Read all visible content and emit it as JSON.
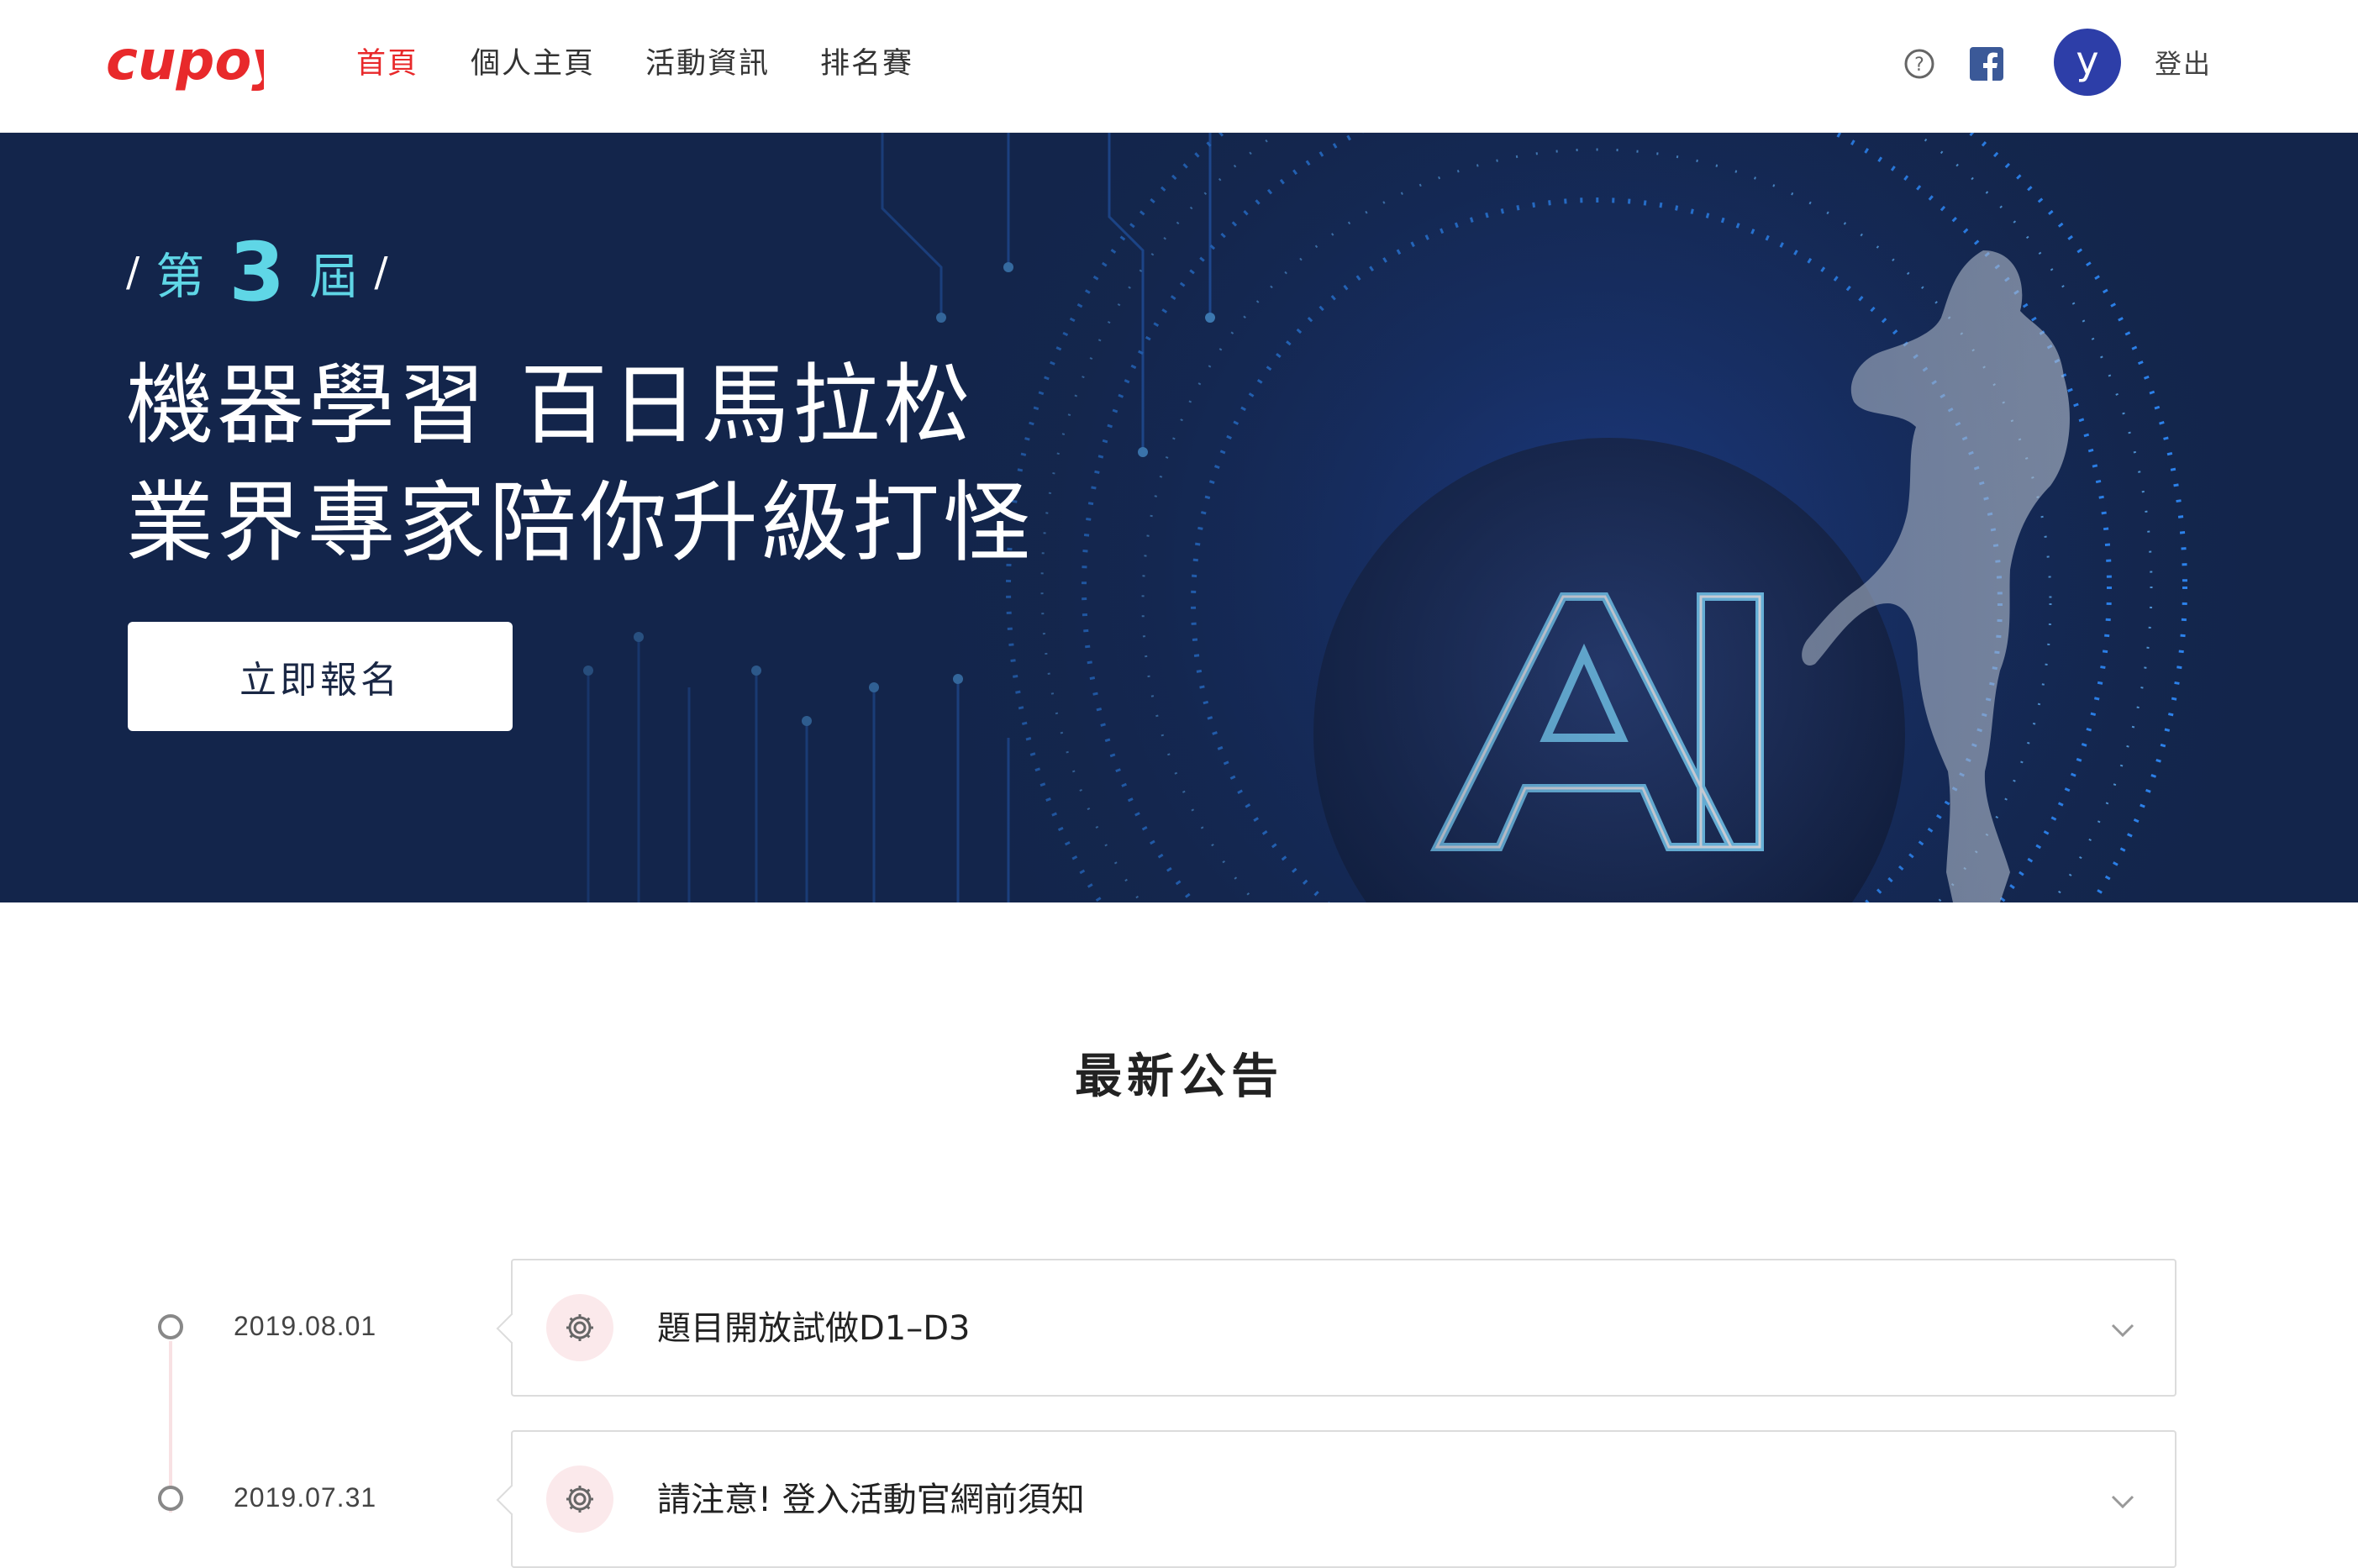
{
  "nav": {
    "logo_text": "cupoy",
    "links": [
      {
        "label": "首頁",
        "active": true
      },
      {
        "label": "個人主頁",
        "active": false
      },
      {
        "label": "活動資訊",
        "active": false
      },
      {
        "label": "排名賽",
        "active": false
      }
    ],
    "help_icon": "question-circle-icon",
    "facebook_icon": "facebook-icon",
    "avatar_letter": "y",
    "logout_label": "登出"
  },
  "hero": {
    "slash_left": "/",
    "edition_prefix": "第",
    "edition_number": "3",
    "edition_suffix": "屆",
    "slash_right": "/",
    "headline_line1": "機器學習 百日馬拉松",
    "headline_line2": "業界專家陪你升級打怪",
    "cta_label": "立即報名",
    "art_text": "AI"
  },
  "news": {
    "section_title": "最新公告",
    "items": [
      {
        "date": "2019.08.01",
        "title": "題目開放試做D1–D3",
        "icon": "gear-icon"
      },
      {
        "date": "2019.07.31",
        "title": "請注意! 登入活動官網前須知",
        "icon": "gear-icon"
      }
    ]
  },
  "colors": {
    "accent_red": "#e8292b",
    "hero_bg": "#13254b",
    "edition_cyan": "#5fd6e6",
    "avatar_bg": "#2d3ea8",
    "facebook_blue": "#3b5998"
  }
}
